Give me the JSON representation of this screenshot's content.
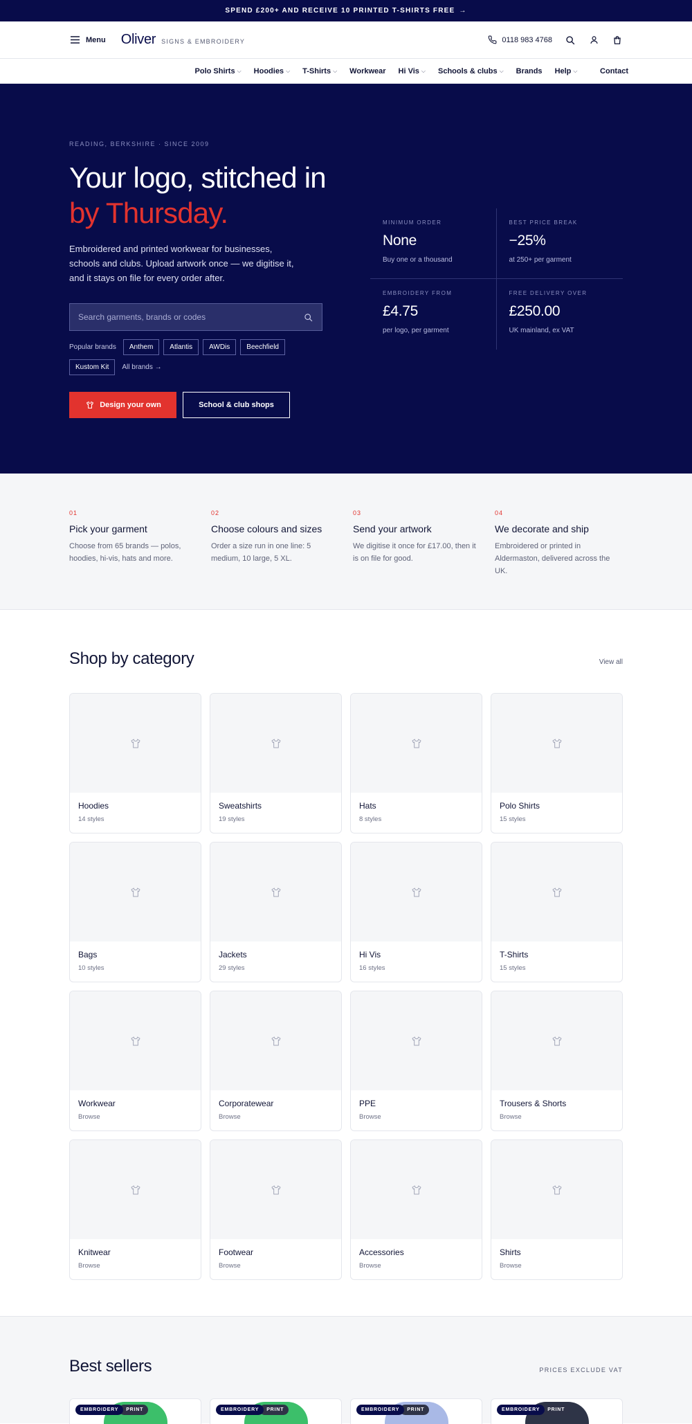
{
  "banner": {
    "text": "SPEND £200+ AND RECEIVE 10 PRINTED T-SHIRTS FREE",
    "arrow": "→"
  },
  "header": {
    "menu_label": "Menu",
    "logo_name": "Oliver",
    "logo_tagline": "SIGNS & EMBROIDERY",
    "phone": "0118 983 4768"
  },
  "nav": {
    "items": [
      {
        "label": "Polo Shirts",
        "dropdown": true
      },
      {
        "label": "Hoodies",
        "dropdown": true
      },
      {
        "label": "T-Shirts",
        "dropdown": true
      },
      {
        "label": "Workwear",
        "dropdown": false
      },
      {
        "label": "Hi Vis",
        "dropdown": true
      },
      {
        "label": "Schools & clubs",
        "dropdown": true
      },
      {
        "label": "Brands",
        "dropdown": false
      },
      {
        "label": "Help",
        "dropdown": true
      }
    ],
    "contact": "Contact"
  },
  "hero": {
    "eyebrow": "READING, BERKSHIRE · SINCE 2009",
    "title_line1": "Your logo, stitched in",
    "title_line2": "by Thursday.",
    "description": "Embroidered and printed workwear for businesses, schools and clubs. Upload artwork once — we digitise it, and it stays on file for every order after.",
    "search_placeholder": "Search garments, brands or codes",
    "popular_label": "Popular brands",
    "brands": [
      "Anthem",
      "Atlantis",
      "AWDis",
      "Beechfield",
      "Kustom Kit"
    ],
    "all_brands": "All brands →",
    "cta_primary": "Design your own",
    "cta_secondary": "School & club shops",
    "stats": [
      {
        "label": "MINIMUM ORDER",
        "value": "None",
        "sub": "Buy one or a thousand"
      },
      {
        "label": "BEST PRICE BREAK",
        "value": "−25%",
        "sub": "at 250+ per garment"
      },
      {
        "label": "EMBROIDERY FROM",
        "value": "£4.75",
        "sub": "per logo, per garment"
      },
      {
        "label": "FREE DELIVERY OVER",
        "value": "£250.00",
        "sub": "UK mainland, ex VAT"
      }
    ]
  },
  "steps": [
    {
      "num": "01",
      "title": "Pick your garment",
      "desc": "Choose from 65 brands — polos, hoodies, hi-vis, hats and more."
    },
    {
      "num": "02",
      "title": "Choose colours and sizes",
      "desc": "Order a size run in one line: 5 medium, 10 large, 5 XL."
    },
    {
      "num": "03",
      "title": "Send your artwork",
      "desc": "We digitise it once for £17.00, then it is on file for good."
    },
    {
      "num": "04",
      "title": "We decorate and ship",
      "desc": "Embroidered or printed in Aldermaston, delivered across the UK."
    }
  ],
  "categories": {
    "title": "Shop by category",
    "view_all": "View all",
    "items": [
      {
        "name": "Hoodies",
        "sub": "14 styles"
      },
      {
        "name": "Sweatshirts",
        "sub": "19 styles"
      },
      {
        "name": "Hats",
        "sub": "8 styles"
      },
      {
        "name": "Polo Shirts",
        "sub": "15 styles"
      },
      {
        "name": "Bags",
        "sub": "10 styles"
      },
      {
        "name": "Jackets",
        "sub": "29 styles"
      },
      {
        "name": "Hi Vis",
        "sub": "16 styles"
      },
      {
        "name": "T-Shirts",
        "sub": "15 styles"
      },
      {
        "name": "Workwear",
        "sub": "Browse"
      },
      {
        "name": "Corporatewear",
        "sub": "Browse"
      },
      {
        "name": "PPE",
        "sub": "Browse"
      },
      {
        "name": "Trousers & Shorts",
        "sub": "Browse"
      },
      {
        "name": "Knitwear",
        "sub": "Browse"
      },
      {
        "name": "Footwear",
        "sub": "Browse"
      },
      {
        "name": "Accessories",
        "sub": "Browse"
      },
      {
        "name": "Shirts",
        "sub": "Browse"
      }
    ]
  },
  "best_sellers": {
    "title": "Best sellers",
    "note": "PRICES EXCLUDE VAT",
    "products": [
      {
        "badge1": "EMBROIDERY",
        "badge2": "PRINT",
        "color": "#3cbf6a"
      },
      {
        "badge1": "EMBROIDERY",
        "badge2": "PRINT",
        "color": "#3cbf6a"
      },
      {
        "badge1": "EMBROIDERY",
        "badge2": "PRINT",
        "color": "#a9b9e6"
      },
      {
        "badge1": "EMBROIDERY",
        "badge2": "PRINT",
        "color": "#2e3447"
      }
    ]
  },
  "colors": {
    "navy": "#080c4a",
    "accent_red": "#e2332e",
    "light_bg": "#f5f6f8"
  }
}
